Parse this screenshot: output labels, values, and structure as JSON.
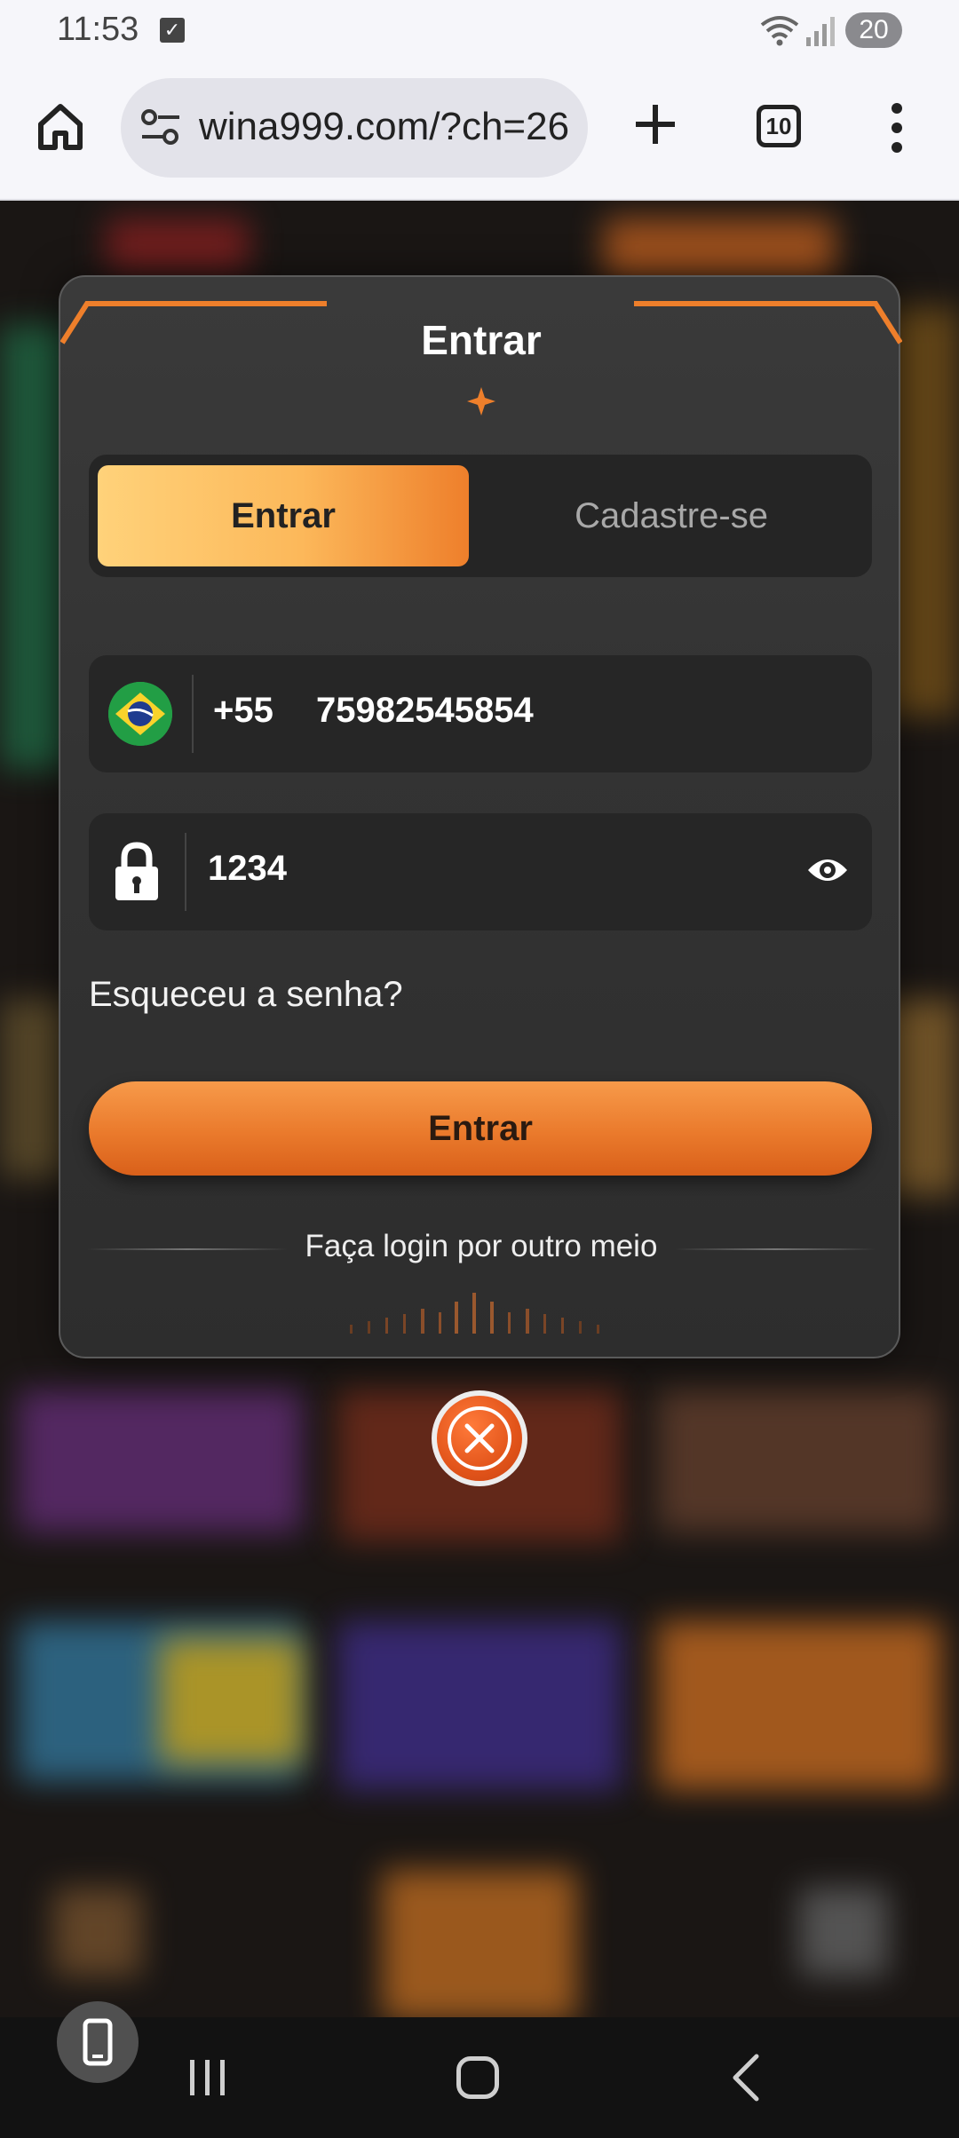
{
  "status_bar": {
    "time": "11:53",
    "battery": "20"
  },
  "browser": {
    "url": "wina999.com/?ch=26",
    "tab_count": "10"
  },
  "modal": {
    "title": "Entrar",
    "tabs": {
      "login_label": "Entrar",
      "register_label": "Cadastre-se",
      "active": "login"
    },
    "phone": {
      "country_flag": "brazil-flag-icon",
      "dial_code": "+55",
      "number": "75982545854"
    },
    "password": {
      "value": "1234"
    },
    "forgot_label": "Esqueceu a senha?",
    "submit_label": "Entrar",
    "other_login_label": "Faça login por outro meio"
  },
  "colors": {
    "accent_orange": "#ea7a2c",
    "tab_gradient_start": "#ffd27a",
    "modal_bg": "#333333"
  }
}
